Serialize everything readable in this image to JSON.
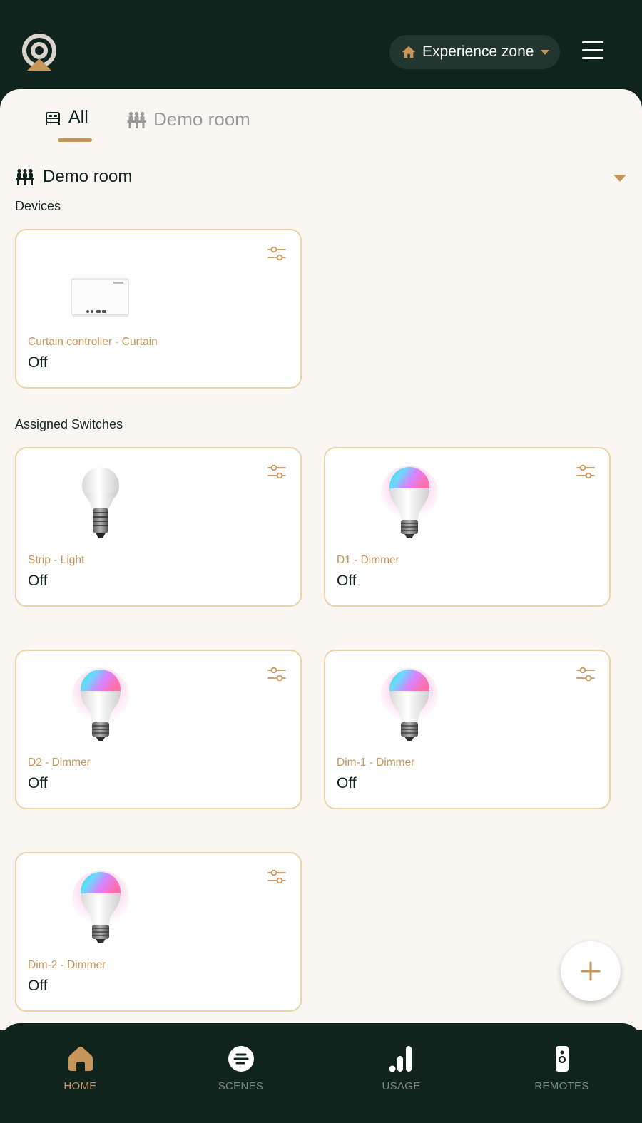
{
  "header": {
    "zone_label": "Experience zone"
  },
  "tabs": [
    {
      "label": "All",
      "active": true
    },
    {
      "label": "Demo room",
      "active": false
    }
  ],
  "room": {
    "title": "Demo room",
    "devices_label": "Devices",
    "switches_label": "Assigned Switches"
  },
  "devices": [
    {
      "name": "Curtain controller - Curtain",
      "state": "Off",
      "icon": "curtain-controller-icon"
    }
  ],
  "switches": [
    {
      "name": "Strip - Light",
      "state": "Off",
      "icon": "white-bulb-icon"
    },
    {
      "name": "D1 - Dimmer",
      "state": "Off",
      "icon": "rgb-bulb-icon"
    },
    {
      "name": "D2 - Dimmer",
      "state": "Off",
      "icon": "rgb-bulb-icon"
    },
    {
      "name": "Dim-1 - Dimmer",
      "state": "Off",
      "icon": "rgb-bulb-icon"
    },
    {
      "name": "Dim-2 - Dimmer",
      "state": "Off",
      "icon": "rgb-bulb-icon"
    }
  ],
  "bottom_nav": [
    {
      "label": "HOME",
      "active": true,
      "icon": "home-icon"
    },
    {
      "label": "SCENES",
      "active": false,
      "icon": "scenes-icon"
    },
    {
      "label": "USAGE",
      "active": false,
      "icon": "usage-bars-icon"
    },
    {
      "label": "REMOTES",
      "active": false,
      "icon": "remote-icon"
    }
  ],
  "colors": {
    "dark": "#10231d",
    "accent": "#c8955a",
    "card_border": "#ecd3ad",
    "background": "#faf7f2"
  }
}
